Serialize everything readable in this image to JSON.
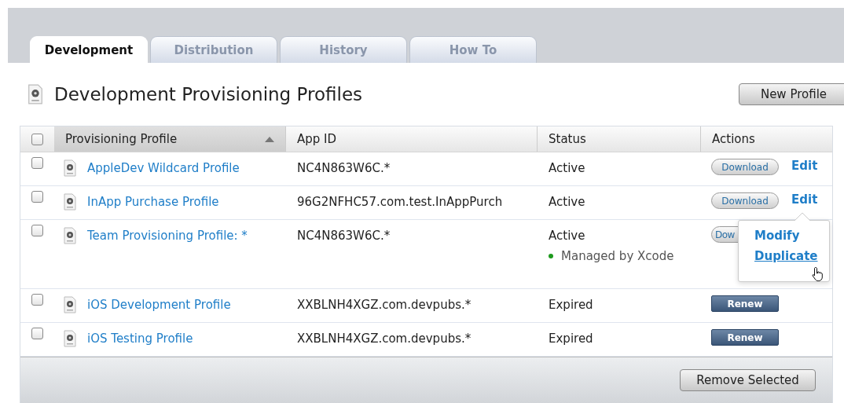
{
  "tabs": [
    {
      "label": "Development",
      "selected": true
    },
    {
      "label": "Distribution",
      "selected": false
    },
    {
      "label": "History",
      "selected": false
    },
    {
      "label": "How To",
      "selected": false
    }
  ],
  "page_title": "Development Provisioning Profiles",
  "new_profile_button": "New Profile",
  "table": {
    "select_all_checked": false,
    "columns": [
      {
        "label": "Provisioning Profile",
        "sorted": true
      },
      {
        "label": "App ID",
        "sorted": false
      },
      {
        "label": "Status",
        "sorted": false
      },
      {
        "label": "Actions",
        "sorted": false
      }
    ],
    "rows": [
      {
        "checked": false,
        "name": "AppleDev Wildcard Profile",
        "app_id": "NC4N863W6C.*",
        "status": "Active",
        "actions": [
          {
            "kind": "download",
            "label": "Download"
          },
          {
            "kind": "edit",
            "label": "Edit"
          }
        ]
      },
      {
        "checked": false,
        "name": "InApp Purchase Profile",
        "app_id": "96G2NFHC57.com.test.InAppPurch",
        "status": "Active",
        "actions": [
          {
            "kind": "download",
            "label": "Download"
          },
          {
            "kind": "edit",
            "label": "Edit"
          }
        ]
      },
      {
        "checked": false,
        "name": "Team Provisioning Profile: *",
        "app_id": "NC4N863W6C.*",
        "status": "Active",
        "note": {
          "text": "Managed by Xcode",
          "color": "#1e9a1e"
        },
        "actions": [
          {
            "kind": "download",
            "label": "Dow"
          }
        ]
      },
      {
        "checked": false,
        "name": "iOS Development Profile",
        "app_id": "XXBLNH4XGZ.com.devpubs.*",
        "status": "Expired",
        "actions": [
          {
            "kind": "renew",
            "label": "Renew"
          }
        ]
      },
      {
        "checked": false,
        "name": "iOS Testing Profile",
        "app_id": "XXBLNH4XGZ.com.devpubs.*",
        "status": "Expired",
        "actions": [
          {
            "kind": "renew",
            "label": "Renew"
          }
        ]
      }
    ],
    "remove_button": "Remove Selected"
  },
  "edit_menu": {
    "items": [
      {
        "label": "Modify",
        "hovered": false
      },
      {
        "label": "Duplicate",
        "hovered": true
      }
    ]
  }
}
